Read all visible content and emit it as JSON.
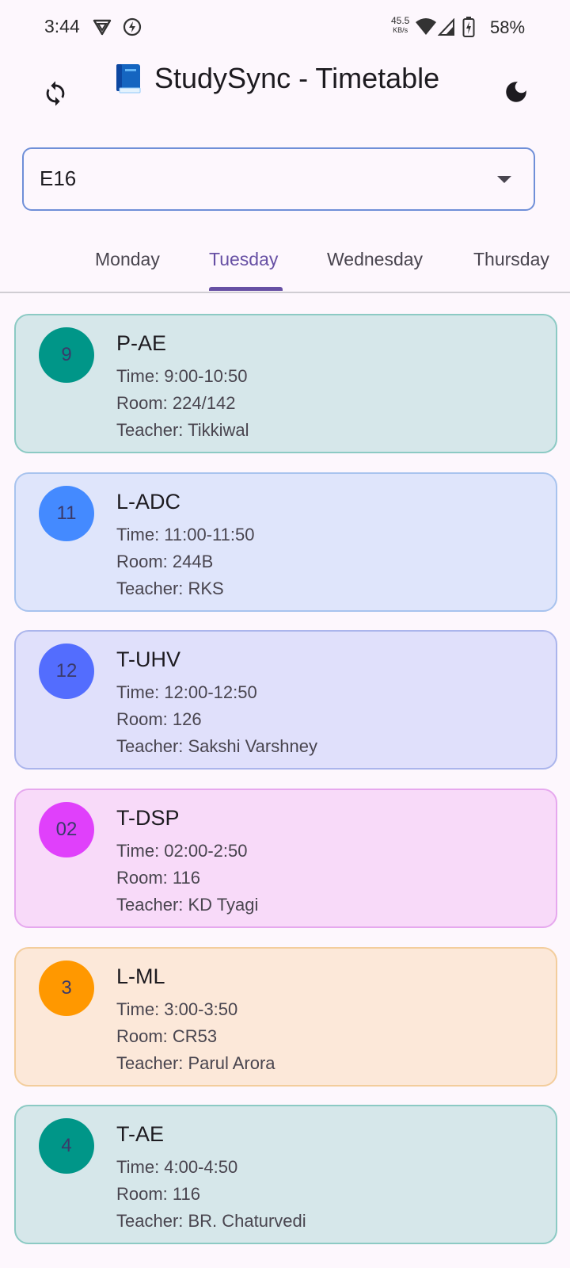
{
  "status_bar": {
    "time": "3:44",
    "net_speed_value": "45.5",
    "net_speed_unit": "KB/s",
    "battery": "58%",
    "icons": [
      "vpn-shield-icon",
      "flash-icon",
      "wifi-icon",
      "signal-icon",
      "battery-icon"
    ]
  },
  "app_bar": {
    "title": "StudySync - Timetable",
    "title_icon": "book-icon",
    "left_icon": "refresh-icon",
    "right_icon": "dark-mode-icon"
  },
  "section_select": {
    "value": "E16"
  },
  "tabs": [
    {
      "label": "Monday",
      "active": false
    },
    {
      "label": "Tuesday",
      "active": true
    },
    {
      "label": "Wednesday",
      "active": false
    },
    {
      "label": "Thursday",
      "active": false
    }
  ],
  "classes": [
    {
      "badge": "9",
      "subject": "P-AE",
      "time": "Time: 9:00-10:50",
      "room": "Room: 224/142",
      "teacher": "Teacher: Tikkiwal",
      "badge_color": "#009688",
      "card_bg": "#D6E7EA",
      "card_border": "#8CCAC4"
    },
    {
      "badge": "11",
      "subject": "L-ADC",
      "time": "Time: 11:00-11:50",
      "room": "Room: 244B",
      "teacher": "Teacher: RKS",
      "badge_color": "#448AFF",
      "card_bg": "#DFE5FB",
      "card_border": "#A8C3EE"
    },
    {
      "badge": "12",
      "subject": "T-UHV",
      "time": "Time: 12:00-12:50",
      "room": "Room: 126",
      "teacher": "Teacher: Sakshi Varshney",
      "badge_color": "#536DFE",
      "card_bg": "#E0E0FB",
      "card_border": "#ABB5EC"
    },
    {
      "badge": "02",
      "subject": "T-DSP",
      "time": "Time: 02:00-2:50",
      "room": "Room: 116",
      "teacher": "Teacher: KD Tyagi",
      "badge_color": "#E040FB",
      "card_bg": "#F8DAF9",
      "card_border": "#E6A8EE"
    },
    {
      "badge": "3",
      "subject": "L-ML",
      "time": "Time: 3:00-3:50",
      "room": "Room: CR53",
      "teacher": "Teacher: Parul Arora",
      "badge_color": "#FF9800",
      "card_bg": "#FCE8D9",
      "card_border": "#F3CD9C"
    },
    {
      "badge": "4",
      "subject": "T-AE",
      "time": "Time: 4:00-4:50",
      "room": "Room: 116",
      "teacher": "Teacher: BR. Chaturvedi",
      "badge_color": "#009688",
      "card_bg": "#D6E7EA",
      "card_border": "#8CCAC4"
    }
  ]
}
